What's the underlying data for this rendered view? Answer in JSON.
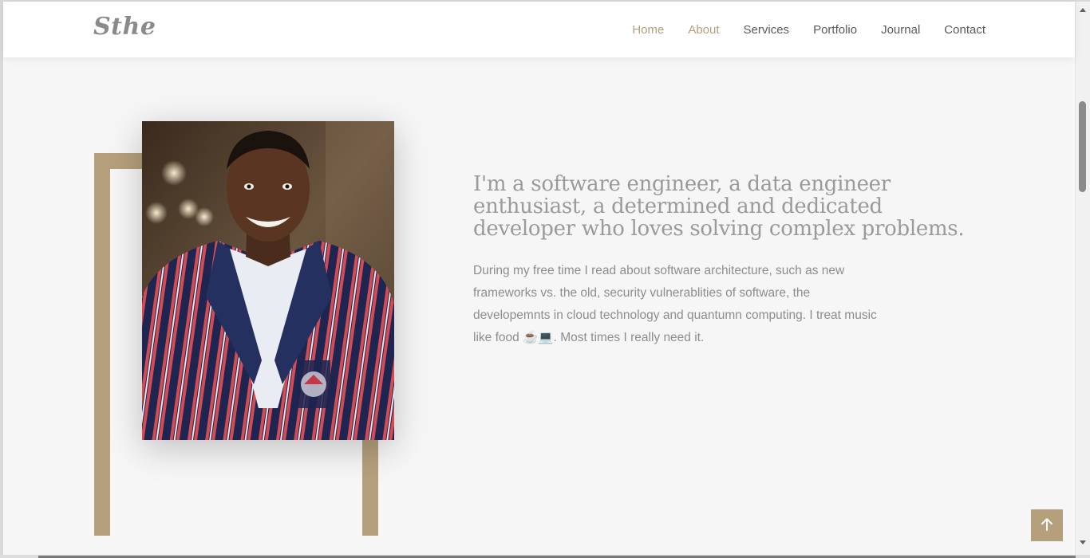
{
  "header": {
    "logo": "Sthe",
    "nav": [
      {
        "label": "Home",
        "active": true
      },
      {
        "label": "About",
        "active": true
      },
      {
        "label": "Services",
        "active": false
      },
      {
        "label": "Portfolio",
        "active": false
      },
      {
        "label": "Journal",
        "active": false
      },
      {
        "label": "Contact",
        "active": false
      }
    ]
  },
  "about": {
    "headline": "I'm a software engineer, a data engineer enthusiast, a determined and dedicated developer who loves solving complex problems.",
    "bio": "During my free time I read about software architecture, such as new frameworks vs. the old, security vulnerablities of software, the developemnts in cloud technology and quantumn computing. I treat music like food ☕💻. Most times I really need it."
  },
  "icons": {
    "scroll_top": "arrow-up-icon"
  },
  "colors": {
    "accent": "#b59f7c",
    "background": "#f6f6f6",
    "heading_text": "#9a9a9a",
    "body_text": "#8d8d8d",
    "nav_text": "#5a5a5a"
  }
}
